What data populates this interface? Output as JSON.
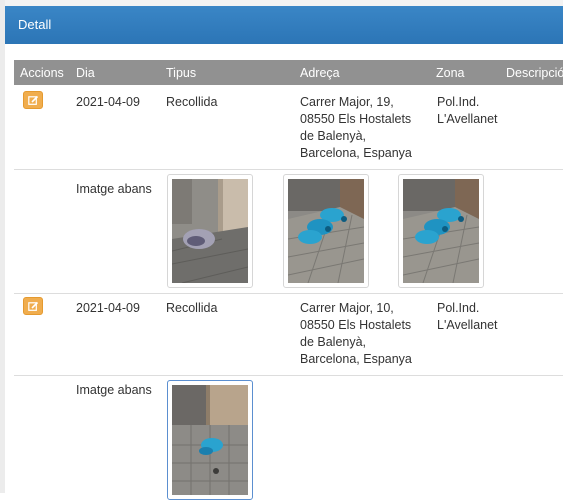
{
  "panel": {
    "title": "Detall"
  },
  "table": {
    "headers": [
      "Accions",
      "Dia",
      "Tipus",
      "Adreça",
      "Zona",
      "Descripció"
    ],
    "rows": [
      {
        "dia": "2021-04-09",
        "tipus": "Recollida",
        "adreca": [
          "Carrer Major, 19,",
          "08550 Els Hostalets",
          "de Balenyà,",
          "Barcelona, Espanya"
        ],
        "zona": [
          "Pol.Ind.",
          "L'Avellanet"
        ],
        "images_label": "Imatge abans",
        "images": [
          "bag-photo",
          "blue-containers-photo",
          "blue-containers-photo"
        ]
      },
      {
        "dia": "2021-04-09",
        "tipus": "Recollida",
        "adreca": [
          "Carrer Major, 10,",
          "08550 Els Hostalets",
          "de Balenyà,",
          "Barcelona, Espanya"
        ],
        "zona": [
          "Pol.Ind.",
          "L'Avellanet"
        ],
        "images_label": "Imatge abans",
        "images": [
          "blue-bag-photo"
        ]
      }
    ]
  },
  "icons": {
    "edit": "edit-icon"
  },
  "colors": {
    "header": "#2c75b6",
    "table_head": "#919191",
    "edit_button": "#f0ad4e"
  }
}
